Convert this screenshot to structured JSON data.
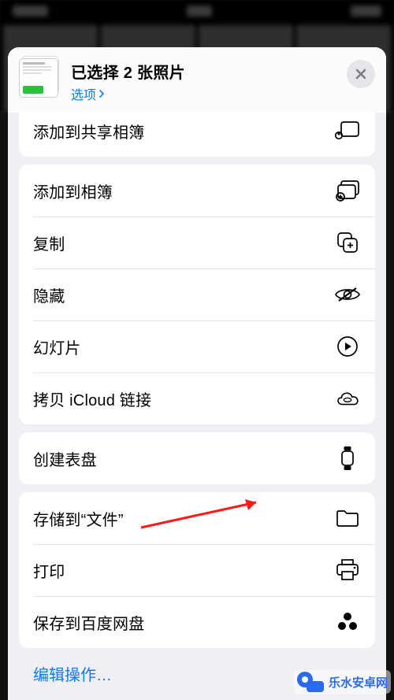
{
  "header": {
    "title": "已选择 2 张照片",
    "options_link": "选项"
  },
  "group1_partial": {
    "action_add_shared_album": "添加到共享相簿"
  },
  "group2": [
    {
      "key": "add_to_album",
      "label": "添加到相簿",
      "icon": "album-add"
    },
    {
      "key": "copy",
      "label": "复制",
      "icon": "copy"
    },
    {
      "key": "hide",
      "label": "隐藏",
      "icon": "eye-off"
    },
    {
      "key": "slideshow",
      "label": "幻灯片",
      "icon": "play-circle"
    },
    {
      "key": "icloud_link",
      "label": "拷贝 iCloud 链接",
      "icon": "cloud-link"
    }
  ],
  "group3": [
    {
      "key": "watch_face",
      "label": "创建表盘",
      "icon": "watch"
    }
  ],
  "group4": [
    {
      "key": "save_files",
      "label": "存储到“文件”",
      "icon": "folder"
    },
    {
      "key": "print",
      "label": "打印",
      "icon": "printer"
    },
    {
      "key": "baidu",
      "label": "保存到百度网盘",
      "icon": "baidu"
    }
  ],
  "footer": {
    "edit_actions": "编辑操作…"
  },
  "watermark": "乐水安卓网"
}
